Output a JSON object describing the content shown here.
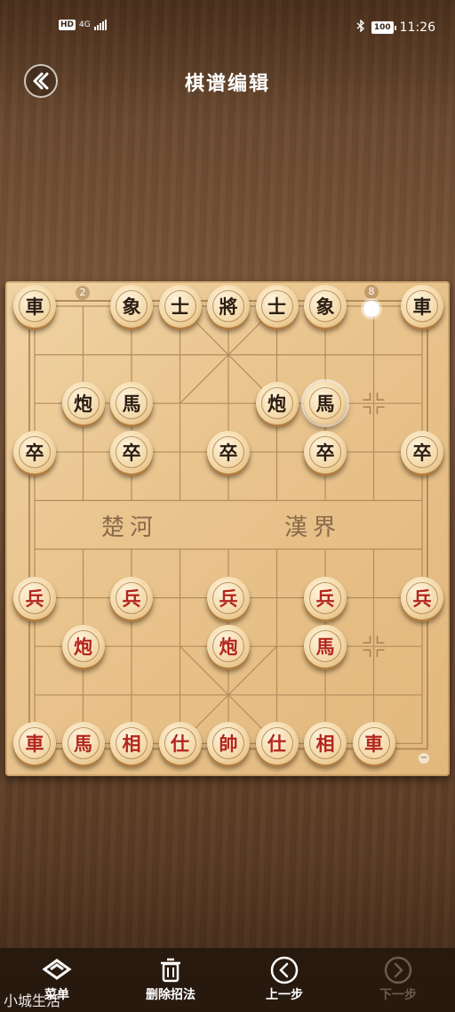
{
  "status": {
    "hd": "HD",
    "network": "4G",
    "battery": "100",
    "time": "11:26"
  },
  "header": {
    "title": "棋谱编辑"
  },
  "board": {
    "river_left": "楚河",
    "river_right": "漢界",
    "col_num_top_left": "2",
    "col_num_top_right": "8",
    "corner_mark": "−"
  },
  "pieces": [
    {
      "c": "車",
      "side": "black",
      "col": 0,
      "row": 0
    },
    {
      "c": "象",
      "side": "black",
      "col": 2,
      "row": 0
    },
    {
      "c": "士",
      "side": "black",
      "col": 3,
      "row": 0
    },
    {
      "c": "將",
      "side": "black",
      "col": 4,
      "row": 0
    },
    {
      "c": "士",
      "side": "black",
      "col": 5,
      "row": 0
    },
    {
      "c": "象",
      "side": "black",
      "col": 6,
      "row": 0
    },
    {
      "c": "車",
      "side": "black",
      "col": 8,
      "row": 0
    },
    {
      "c": "炮",
      "side": "black",
      "col": 1,
      "row": 2
    },
    {
      "c": "馬",
      "side": "black",
      "col": 2,
      "row": 2
    },
    {
      "c": "炮",
      "side": "black",
      "col": 5,
      "row": 2
    },
    {
      "c": "馬",
      "side": "black",
      "col": 6,
      "row": 2,
      "selected": true
    },
    {
      "c": "卒",
      "side": "black",
      "col": 0,
      "row": 3
    },
    {
      "c": "卒",
      "side": "black",
      "col": 2,
      "row": 3
    },
    {
      "c": "卒",
      "side": "black",
      "col": 4,
      "row": 3
    },
    {
      "c": "卒",
      "side": "black",
      "col": 6,
      "row": 3
    },
    {
      "c": "卒",
      "side": "black",
      "col": 8,
      "row": 3
    },
    {
      "c": "兵",
      "side": "red",
      "col": 0,
      "row": 6
    },
    {
      "c": "兵",
      "side": "red",
      "col": 2,
      "row": 6
    },
    {
      "c": "兵",
      "side": "red",
      "col": 4,
      "row": 6
    },
    {
      "c": "兵",
      "side": "red",
      "col": 6,
      "row": 6
    },
    {
      "c": "兵",
      "side": "red",
      "col": 8,
      "row": 6
    },
    {
      "c": "炮",
      "side": "red",
      "col": 1,
      "row": 7
    },
    {
      "c": "炮",
      "side": "red",
      "col": 4,
      "row": 7
    },
    {
      "c": "馬",
      "side": "red",
      "col": 6,
      "row": 7
    },
    {
      "c": "車",
      "side": "red",
      "col": 0,
      "row": 9
    },
    {
      "c": "馬",
      "side": "red",
      "col": 1,
      "row": 9
    },
    {
      "c": "相",
      "side": "red",
      "col": 2,
      "row": 9
    },
    {
      "c": "仕",
      "side": "red",
      "col": 3,
      "row": 9
    },
    {
      "c": "帥",
      "side": "red",
      "col": 4,
      "row": 9
    },
    {
      "c": "仕",
      "side": "red",
      "col": 5,
      "row": 9
    },
    {
      "c": "相",
      "side": "red",
      "col": 6,
      "row": 9
    },
    {
      "c": "車",
      "side": "red",
      "col": 7,
      "row": 9
    }
  ],
  "toolbar": {
    "menu": "菜单",
    "delete": "删除招法",
    "prev": "上一步",
    "next": "下一步"
  },
  "watermark": "小城生活"
}
